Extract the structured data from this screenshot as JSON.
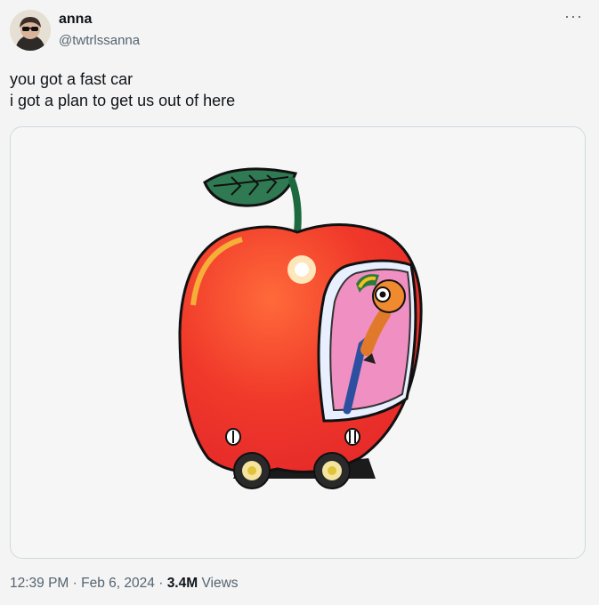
{
  "author": {
    "name": "anna",
    "handle": "@twtrlssanna"
  },
  "tweet": {
    "lines": [
      "you got a fast car",
      "i got a plan to get us out of here"
    ]
  },
  "media": {
    "image_alt": "Cartoon red apple shaped like a car with a worm driving it"
  },
  "meta": {
    "time": "12:39 PM",
    "sep1": "·",
    "date": "Feb 6, 2024",
    "sep2": "·",
    "views_count": "3.4M",
    "views_label": "Views"
  },
  "icons": {
    "more": "more-options-icon"
  }
}
